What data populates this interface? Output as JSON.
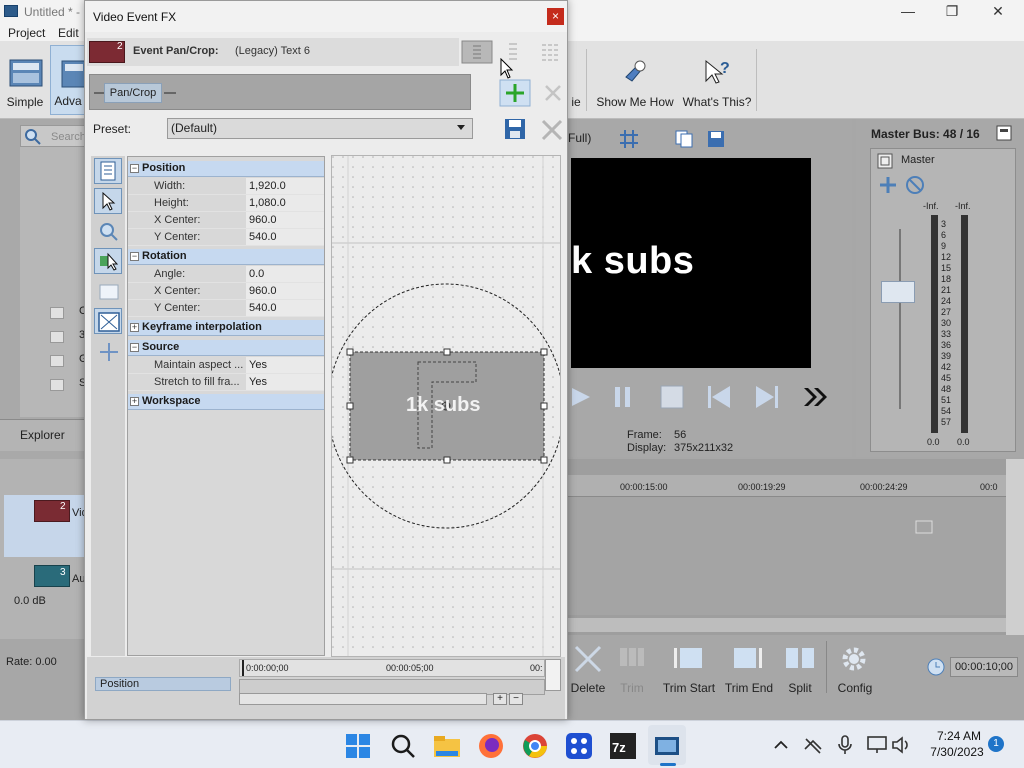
{
  "app": {
    "title": "Untitled * -",
    "menu": [
      "Project",
      "Edit"
    ],
    "toolbar": [
      {
        "label": "Simple",
        "icon": "simple-layout-icon"
      },
      {
        "label": "Adva",
        "icon": "advanced-layout-icon"
      },
      {
        "label": "ie",
        "icon": "partial-icon"
      },
      {
        "label": "Show Me How",
        "icon": "pointing-hand-icon"
      },
      {
        "label": "What's This?",
        "icon": "help-cursor-icon"
      }
    ],
    "window_controls": [
      "—",
      "❐",
      "✕"
    ]
  },
  "left_pane": {
    "search_placeholder": "Search",
    "tree_items": [
      "C",
      "3",
      "G",
      "S"
    ],
    "explorer_tab": "Explorer",
    "tracks": [
      {
        "num": "2",
        "label": "Vid"
      },
      {
        "num": "3",
        "label": "Au"
      }
    ],
    "volume": "0.0 dB",
    "rate": "Rate: 0.00"
  },
  "preview": {
    "quality": "Full)",
    "video_text": "k subs",
    "frame_label": "Frame:",
    "frame_value": "56",
    "display_label": "Display:",
    "display_value": "375x211x32"
  },
  "master": {
    "title": "Master Bus: 48 / 16",
    "label": "Master",
    "left_peak": "-Inf.",
    "right_peak": "-Inf.",
    "scale": [
      "3",
      "6",
      "9",
      "12",
      "15",
      "18",
      "21",
      "24",
      "27",
      "30",
      "33",
      "36",
      "39",
      "42",
      "45",
      "48",
      "51",
      "54",
      "57"
    ],
    "left_value": "0.0",
    "right_value": "0.0"
  },
  "timeline": {
    "ticks": [
      "00:00:15:00",
      "00:00:19:29",
      "00:00:24:29",
      "00:0"
    ]
  },
  "edit_toolbar": {
    "buttons": [
      "Delete",
      "Trim",
      "Trim Start",
      "Trim End",
      "Split",
      "Config"
    ],
    "time": "00:00:10;00"
  },
  "dialog": {
    "title": "Video Event FX",
    "close": "×",
    "header_badge": "2",
    "header_label": "Event Pan/Crop:",
    "header_value": "(Legacy) Text 6",
    "chain_item": "Pan/Crop",
    "preset_label": "Preset:",
    "preset_value": "(Default)",
    "sections": {
      "position": {
        "title": "Position",
        "rows": [
          {
            "name": "Width:",
            "value": "1,920.0"
          },
          {
            "name": "Height:",
            "value": "1,080.0"
          },
          {
            "name": "X Center:",
            "value": "960.0"
          },
          {
            "name": "Y Center:",
            "value": "540.0"
          }
        ]
      },
      "rotation": {
        "title": "Rotation",
        "rows": [
          {
            "name": "Angle:",
            "value": "0.0"
          },
          {
            "name": "X Center:",
            "value": "960.0"
          },
          {
            "name": "Y Center:",
            "value": "540.0"
          }
        ]
      },
      "keyframe": {
        "title": "Keyframe interpolation"
      },
      "source": {
        "title": "Source",
        "rows": [
          {
            "name": "Maintain aspect ...",
            "value": "Yes"
          },
          {
            "name": "Stretch to fill fra...",
            "value": "Yes"
          }
        ]
      },
      "workspace": {
        "title": "Workspace"
      }
    },
    "canvas_text": "1k subs",
    "keyframe_row": "Position",
    "kf_ticks": [
      "0:00:00;00",
      "00:00:05;00",
      "00:"
    ]
  },
  "taskbar": {
    "time": "7:24 AM",
    "date": "7/30/2023",
    "notification_count": "1",
    "apps": [
      "start-icon",
      "search-icon",
      "file-explorer-icon",
      "firefox-icon",
      "chrome-icon",
      "app-dots-icon",
      "7zip-icon",
      "vegas-icon"
    ]
  },
  "colors": {
    "selection_blue": "#c6d9f0",
    "close_red": "#c42b1c",
    "accent": "#1f74c8"
  }
}
